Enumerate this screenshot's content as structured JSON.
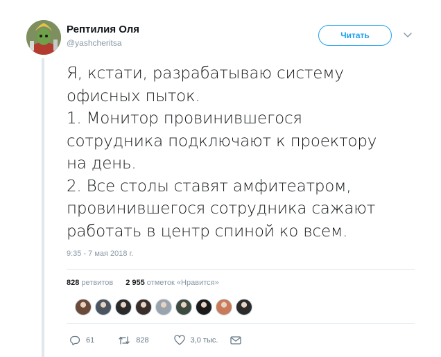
{
  "author": {
    "name": "Рептилия Оля",
    "handle": "@yashcheritsa"
  },
  "follow_button": {
    "label": "Читать"
  },
  "tweet": {
    "text": "Я, кстати, разрабатываю систему\nофисных пыток.\n1. Монитор провинившегося\nсотрудника подключают к проектору\nна день.\n2. Все столы ставят амфитеатром,\nпровинившегося сотрудника сажают\nработать в центр спиной ко всем.",
    "timestamp": "9:35 - 7 мая 2018 г."
  },
  "stats": {
    "retweets_count": "828",
    "retweets_label": "ретвитов",
    "likes_count": "2 955",
    "likes_label": "отметок «Нравится»"
  },
  "likers": [
    {
      "color": "#6b4a3a"
    },
    {
      "color": "#4a5560"
    },
    {
      "color": "#2a2a2a"
    },
    {
      "color": "#3a2e2a"
    },
    {
      "color": "#9aa4ae"
    },
    {
      "color": "#3d4a40"
    },
    {
      "color": "#1a1a1a"
    },
    {
      "color": "#c97a5a"
    },
    {
      "color": "#2b2b2b"
    }
  ],
  "actions": {
    "replies": "61",
    "retweets": "828",
    "likes": "3,0 тыс."
  },
  "colors": {
    "accent": "#1da1f2",
    "muted": "#8899a6",
    "text": "#14171a"
  }
}
